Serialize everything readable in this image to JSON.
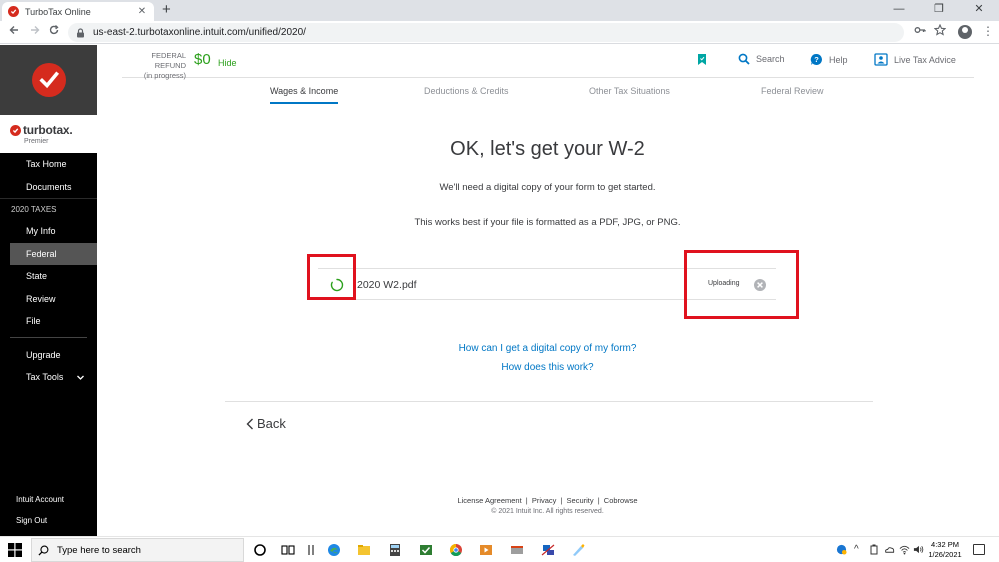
{
  "browser": {
    "tab_title": "TurboTax Online",
    "tab_close": "✕",
    "new_tab": "+",
    "minimize": "—",
    "maximize": "❐",
    "close": "✕",
    "url": "us-east-2.turbotaxonline.intuit.com/unified/2020/"
  },
  "sidebar": {
    "brand_name": "turbotax.",
    "brand_edition": "Premier",
    "items": [
      {
        "label": "Tax Home"
      },
      {
        "label": "Documents"
      }
    ],
    "section_label": "2020 TAXES",
    "section_items": [
      {
        "label": "My Info"
      },
      {
        "label": "Federal"
      },
      {
        "label": "State"
      },
      {
        "label": "Review"
      },
      {
        "label": "File"
      }
    ],
    "upgrade": "Upgrade",
    "tax_tools": "Tax Tools",
    "intuit_account": "Intuit Account",
    "sign_out": "Sign Out"
  },
  "header": {
    "refund_label_1": "FEDERAL REFUND",
    "refund_label_2": "(in progress)",
    "refund_amount": "$0",
    "refund_hide": "Hide",
    "search": "Search",
    "help": "Help",
    "live_advice": "Live Tax Advice"
  },
  "steps": [
    {
      "label": "Wages & Income",
      "active": true
    },
    {
      "label": "Deductions & Credits"
    },
    {
      "label": "Other Tax Situations"
    },
    {
      "label": "Federal Review"
    }
  ],
  "main": {
    "title": "OK, let's get your W-2",
    "subtitle": "We'll need a digital copy of your form to get started.",
    "subtitle2": "This works best if your file is formatted as a PDF, JPG, or PNG.",
    "file_name": "2020 W2.pdf",
    "upload_status": "Uploading",
    "link_copy": "How can I get a digital copy of my form?",
    "link_how": "How does this work?",
    "back": "Back"
  },
  "footer": {
    "license": "License Agreement",
    "privacy": "Privacy",
    "security": "Security",
    "cobrowse": "Cobrowse",
    "sep": "|",
    "copyright": "© 2021 Intuit Inc. All rights reserved."
  },
  "taskbar": {
    "search_placeholder": "Type here to search",
    "time": "4:32 PM",
    "date": "1/26/2021"
  },
  "colors": {
    "brand_red": "#d52b1e",
    "accent_green": "#2ca01c",
    "link_blue": "#0077c5",
    "highlight_red": "#e0121e",
    "sidebar_bg": "#000000"
  }
}
